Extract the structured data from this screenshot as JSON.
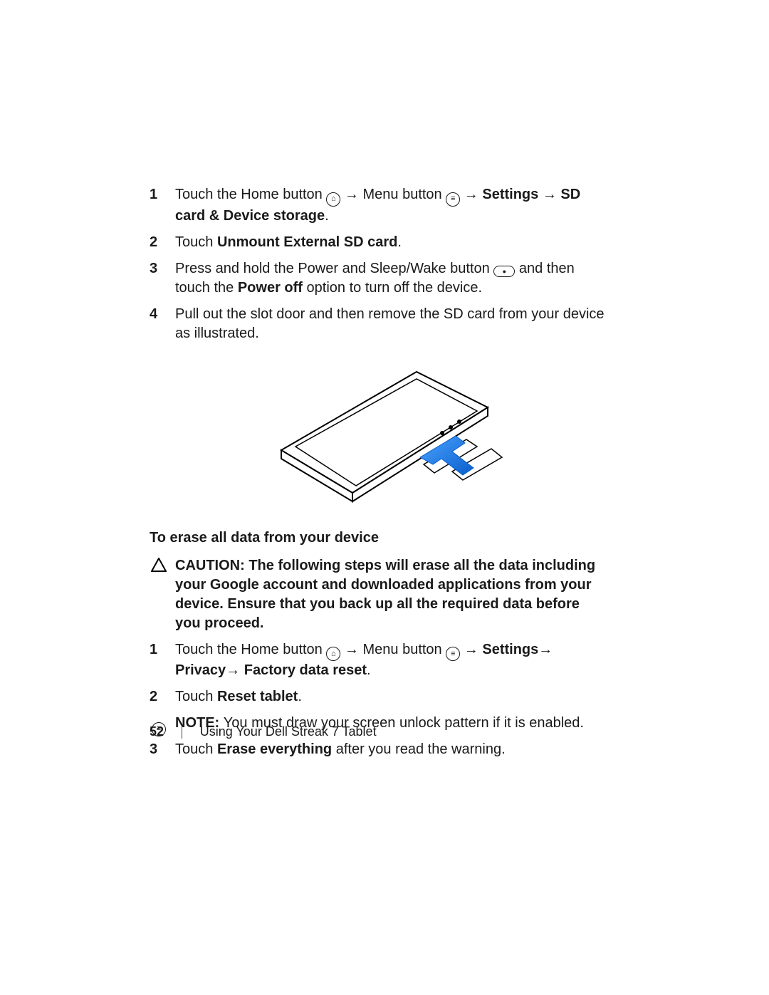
{
  "steps_a": {
    "s1": {
      "num": "1",
      "t1": "Touch the Home button ",
      "arrow1": " → ",
      "t2": "Menu button ",
      "arrow2": " → ",
      "b1": "Settings",
      "arrow3": "→ ",
      "b2": "SD card & Device storage",
      "t3": "."
    },
    "s2": {
      "num": "2",
      "t1": "Touch ",
      "b1": "Unmount External SD card",
      "t2": "."
    },
    "s3": {
      "num": "3",
      "t1": "Press and hold the Power and Sleep/Wake button ",
      "t2": " and then touch the ",
      "b1": "Power off",
      "t3": " option to turn off the device."
    },
    "s4": {
      "num": "4",
      "t1": "Pull out the slot door and then remove the SD card from your device as illustrated."
    }
  },
  "section2_heading": "To erase all data from your device",
  "caution": {
    "label": "CAUTION: ",
    "text": "The following steps will erase all the data including your Google account and downloaded applications from your device. Ensure that you back up all the required data before you proceed."
  },
  "steps_b": {
    "s1": {
      "num": "1",
      "t1": "Touch the Home button ",
      "arrow1": " → ",
      "t2": "Menu button ",
      "arrow2": " → ",
      "b1": "Settings",
      "arrow3": "→ ",
      "b2": "Privacy",
      "arrow4": "→ ",
      "b3": "Factory data reset",
      "t3": "."
    },
    "s2": {
      "num": "2",
      "t1": "Touch ",
      "b1": "Reset tablet",
      "t2": "."
    }
  },
  "note": {
    "label": "NOTE: ",
    "text": "You must draw your screen unlock pattern if it is enabled."
  },
  "steps_c": {
    "s3": {
      "num": "3",
      "t1": "Touch ",
      "b1": "Erase everything",
      "t2": " after you read the warning."
    }
  },
  "footer": {
    "page": "52",
    "vr": "|",
    "title": "Using Your Dell Streak 7 Tablet"
  }
}
